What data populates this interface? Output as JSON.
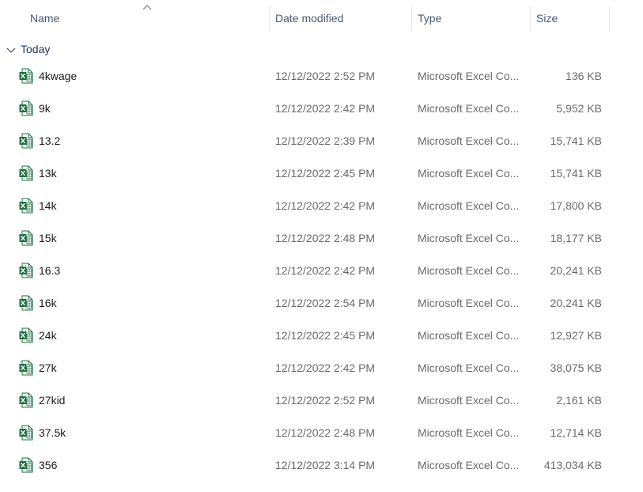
{
  "columns": {
    "name": "Name",
    "date_modified": "Date modified",
    "type": "Type",
    "size": "Size"
  },
  "group": {
    "label": "Today",
    "icon": "chevron-down-icon"
  },
  "file_icon": "excel-file-icon",
  "colors": {
    "excel_green": "#1d6f42",
    "header_text": "#4a5a70",
    "group_text": "#1f3a6b"
  },
  "files": [
    {
      "name": "4kwage",
      "date": "12/12/2022 2:52 PM",
      "type": "Microsoft Excel Co...",
      "size": "136 KB"
    },
    {
      "name": "9k",
      "date": "12/12/2022 2:42 PM",
      "type": "Microsoft Excel Co...",
      "size": "5,952 KB"
    },
    {
      "name": "13.2",
      "date": "12/12/2022 2:39 PM",
      "type": "Microsoft Excel Co...",
      "size": "15,741 KB"
    },
    {
      "name": "13k",
      "date": "12/12/2022 2:45 PM",
      "type": "Microsoft Excel Co...",
      "size": "15,741 KB"
    },
    {
      "name": "14k",
      "date": "12/12/2022 2:42 PM",
      "type": "Microsoft Excel Co...",
      "size": "17,800 KB"
    },
    {
      "name": "15k",
      "date": "12/12/2022 2:48 PM",
      "type": "Microsoft Excel Co...",
      "size": "18,177 KB"
    },
    {
      "name": "16.3",
      "date": "12/12/2022 2:42 PM",
      "type": "Microsoft Excel Co...",
      "size": "20,241 KB"
    },
    {
      "name": "16k",
      "date": "12/12/2022 2:54 PM",
      "type": "Microsoft Excel Co...",
      "size": "20,241 KB"
    },
    {
      "name": "24k",
      "date": "12/12/2022 2:45 PM",
      "type": "Microsoft Excel Co...",
      "size": "12,927 KB"
    },
    {
      "name": "27k",
      "date": "12/12/2022 2:42 PM",
      "type": "Microsoft Excel Co...",
      "size": "38,075 KB"
    },
    {
      "name": "27kid",
      "date": "12/12/2022 2:52 PM",
      "type": "Microsoft Excel Co...",
      "size": "2,161 KB"
    },
    {
      "name": "37.5k",
      "date": "12/12/2022 2:48 PM",
      "type": "Microsoft Excel Co...",
      "size": "12,714 KB"
    },
    {
      "name": "356",
      "date": "12/12/2022 3:14 PM",
      "type": "Microsoft Excel Co...",
      "size": "413,034 KB"
    }
  ]
}
